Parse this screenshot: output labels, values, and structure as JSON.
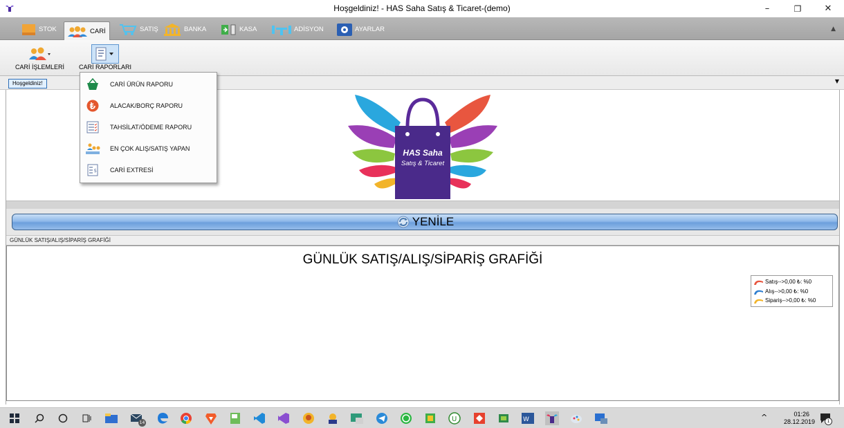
{
  "window": {
    "title": "Hoşgeldiniz! - HAS Saha Satış & Ticaret-(demo)",
    "minimize": "–",
    "restore": "❐",
    "close": "✕"
  },
  "ribbon_tabs": [
    {
      "label": "STOK",
      "icon": "box-icon"
    },
    {
      "label": "CARİ",
      "icon": "users-icon"
    },
    {
      "label": "SATIŞ",
      "icon": "cart-icon"
    },
    {
      "label": "BANKA",
      "icon": "bank-icon"
    },
    {
      "label": "KASA",
      "icon": "cashbox-icon"
    },
    {
      "label": "ADİSYON",
      "icon": "table-icon"
    },
    {
      "label": "AYARLAR",
      "icon": "gear-icon"
    }
  ],
  "ribbon_collapse": "▲",
  "ribbon_buttons": [
    {
      "label": "CARİ İŞLEMLERİ",
      "icon": "users-icon"
    },
    {
      "label": "CARİ RAPORLARI",
      "icon": "report-icon"
    }
  ],
  "doc_tab": "Hoşgeldiniz!",
  "doc_strip_arrow": "▼",
  "dropdown": {
    "items": [
      {
        "label": "CARİ ÜRÜN RAPORU",
        "icon": "basket-icon"
      },
      {
        "label": "ALACAK/BORÇ RAPORU",
        "icon": "lira-icon"
      },
      {
        "label": "TAHSİLAT/ÖDEME RAPORU",
        "icon": "checklist-icon"
      },
      {
        "label": "EN ÇOK ALIŞ/SATIŞ YAPAN",
        "icon": "ranking-icon"
      },
      {
        "label": "CARİ EXTRESİ",
        "icon": "statement-icon"
      }
    ]
  },
  "logo": {
    "line1": "HAS Saha",
    "line2": "Satış & Ticaret"
  },
  "refresh_button": "YENİLE",
  "group_header": "GÜNLÜK SATIŞ/ALIŞ/SİPARİŞ GRAFİĞİ",
  "chart_title": "GÜNLÜK SATIŞ/ALIŞ/SİPARİŞ GRAFİĞİ",
  "legend": [
    {
      "label": "Satış-->0,00 ₺: %0",
      "color": "#e8563f"
    },
    {
      "label": "Alış-->0,00 ₺: %0",
      "color": "#2f7fd0"
    },
    {
      "label": "Sipariş-->0,00 ₺: %0",
      "color": "#f2b42a"
    }
  ],
  "taskbar": {
    "icons": [
      "start-icon",
      "search-icon",
      "cortana-icon",
      "taskview-icon",
      "explorer-icon",
      "mail-icon",
      "edge-icon",
      "chrome-icon",
      "brave-icon",
      "notepad-icon",
      "vscode-icon",
      "visualstudio-icon",
      "app-icon",
      "app2-icon",
      "app3-icon",
      "telegram-icon",
      "whatsapp-icon",
      "app4-icon",
      "upwork-icon",
      "anydesk-icon",
      "app5-icon",
      "word-icon",
      "has-icon",
      "paint-icon",
      "app6-icon"
    ],
    "mail_badge": "14",
    "tray_caret": "^",
    "time": "01:26",
    "date": "28.12.2019",
    "notification_badge": "1"
  }
}
